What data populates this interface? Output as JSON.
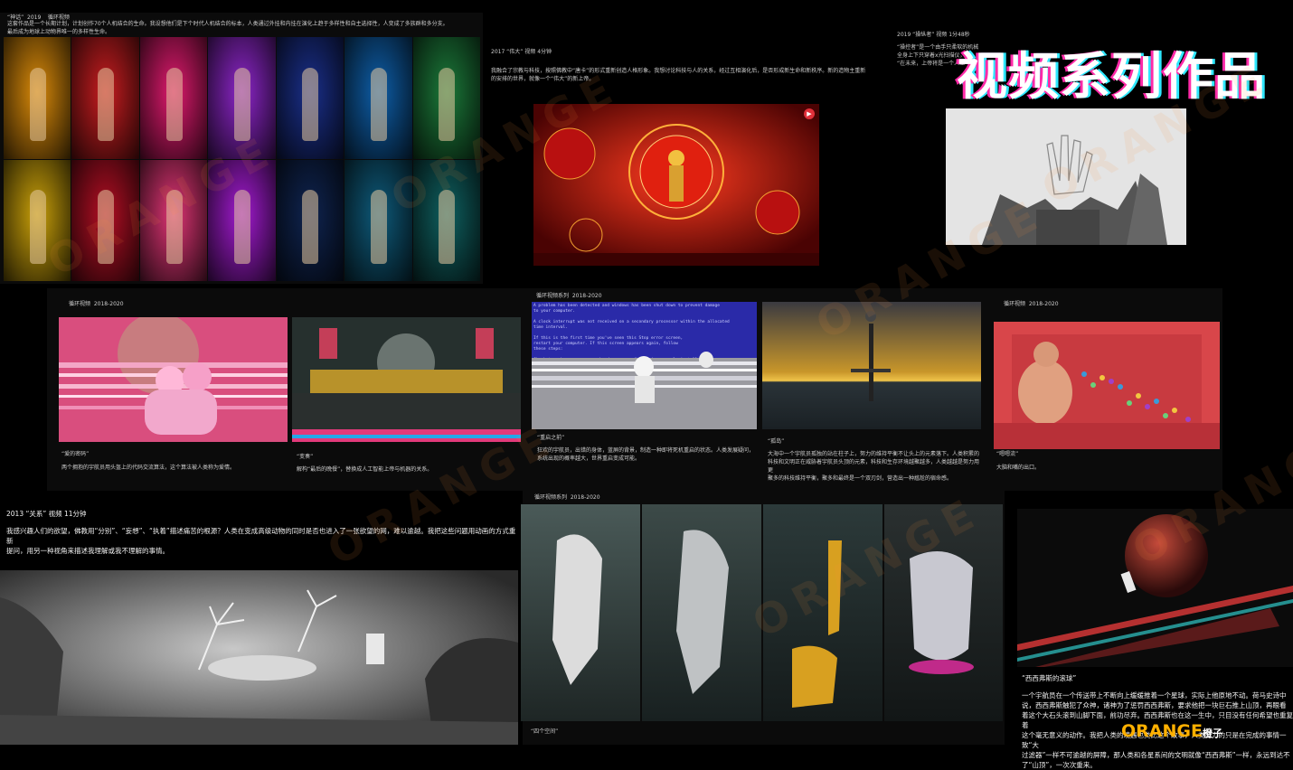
{
  "page_title": "视频系列作品",
  "watermark": {
    "text": "ORANGE",
    "logo_main": "ORANGE",
    "logo_sub": "橙子",
    "color": "#ff9a3c"
  },
  "works": {
    "shenhua": {
      "title": "“神话”  2019    循环视频",
      "desc": "这套作品是一个长期计划，计划创作70个人机结合的生命。我设想他们是下个时代人机结合的标本，人类通过外挂和内挂在演化上趋于多样性和自主选择性，人变成了多族群和多分支。\n最后成为地球上动物界唯一的多样性生命。",
      "tile_colors": [
        "#d98a0a",
        "#c81d20",
        "#e01a6e",
        "#8d26c9",
        "#1a2f8a",
        "#0e5ea8",
        "#1c7a3a",
        "#c9a00a",
        "#b40f24",
        "#e03575",
        "#a21bd0",
        "#0f2450",
        "#0e5a7a",
        "#0f6060"
      ]
    },
    "weida": {
      "title": "2017 “伟大” 视频 4分钟",
      "desc": "我融合了宗教与科技，按照佛教中“唐卡”的形式重新创造人格形象。我想讨论科技与人的关系，经过互相演化后，是否形成新生命和新秩序。新的造物主重新的安排的世界，就像一个“伟大”的新上帝。"
    },
    "caozongzhe": {
      "title": "2019 “操纵者” 视频 1分48秒",
      "desc": "“操控者”是一个由手只柔软的机械\n全身上下只穿着x光扫描仪，\n“在未来，上帝将是一个人工"
    },
    "loop1": {
      "title": "循环视频  2018-2020",
      "item1_title": "“爱的密码”",
      "item1_desc": "两个拥抱的宇航员用头盔上的代码交流算法，这个算法被人类称为爱情。",
      "item2_title": "“变奏”",
      "item2_desc": "解构“最后的晚餐”，替换成人工智能上帝与机器的关系。"
    },
    "loop2": {
      "title": "循环视频系列  2018-2020",
      "item1_title": "“重启之前”",
      "item1_desc": "狂欢的宇航员，出错的身体，蓝屏的背景，制造一种即将死机重启的状态。人类发展疑问，\n系统出现的概率越大，世界重启变成可能。",
      "bsod_text": "A problem has been detected and windows has been shut down to prevent damage\nto your computer.\n\nA clock interrupt was not received on a secondary processor within the allocated\ntime interval.\n\nIf this is the first time you've seen this Stop error screen,\nrestart your computer. If this screen appears again, follow\nthese steps:\n\nCheck to make sure any new hardware or software is properly installed.\nIf this is a new installation, ask your hardware or software manufacturer\nfor any windows updates you might need.",
      "item2_title": "“孤岛”",
      "item2_desc": "大海中一个宇航员孤独的站在柱子上，努力的维持平衡不让头上的元素落下。人类积累的\n科技和文明正在威胁着宇航员头顶的元素，科技和生存环境越聚越多，人类越越是努力用更\n聚多的科技维持平衡，聚多和最终是一个双刃剑，营造出一种尴尬的宿命感。"
    },
    "loop3": {
      "title": "循环视频  2018-2020",
      "item1_title": "“嗯嗯流”",
      "item1_desc": "大脑和嘴的出口。"
    },
    "guanxi": {
      "title": "2013 “关系” 视频 11分钟",
      "desc": "我感兴趣人们的欲望，佛教用“分别”、“妄想”、“执着”描述痛苦的根源？人类在变成高级动物的同时是否也进入了一张欲望的网，难以逾越。我把这些问题用动画的方式重新\n提问，用另一种视角来描述我理解或我不理解的事情。"
    },
    "loop4": {
      "title": "循环视频系列  2018-2020",
      "caption": "“四个空间”"
    },
    "sisyphus": {
      "title": "“西西弗斯的滚球”",
      "desc": "一个宇航员在一个传送带上不断向上缓缓推着一个星球，实际上他原地不动。荷马史诗中\n说，西西弗斯触犯了众神，诸神为了惩罚西西弗斯，要求他把一块巨石推上山顶，再眼看\n着这个大石头滚到山脚下面，前功尽弃。西西弗斯也在这一生中，只目没有任何希望也重复着\n这个毫无意义的动作。我把人类的境遇也类比这个故事，人类努力的只是在完成的事情一致“大\n过滤器”一样不可逾越的屏障，那人类和各星系间的文明就像“西西弗斯”一样，永远到达不\n了“山顶”，一次次重来。"
    }
  }
}
